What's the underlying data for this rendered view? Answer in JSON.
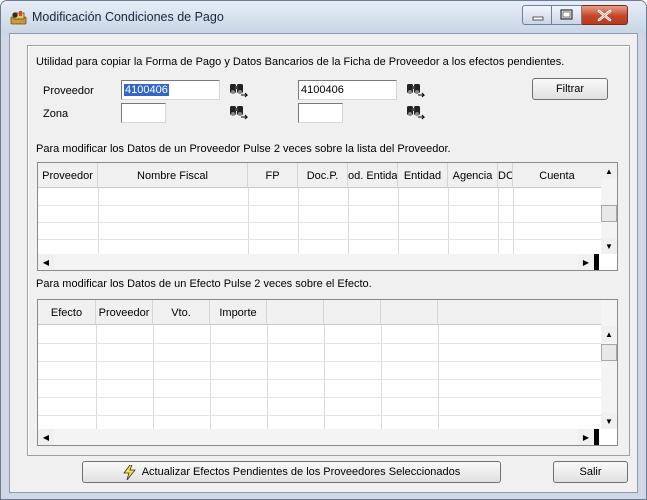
{
  "window": {
    "title": "Modificación Condiciones de Pago"
  },
  "header": {
    "info_text": "Utilidad para copiar la Forma de Pago y Datos Bancarios de la Ficha de Proveedor a los efectos pendientes."
  },
  "filters": {
    "proveedor_label": "Proveedor",
    "proveedor_from": "4100406",
    "proveedor_to": "4100406",
    "zona_label": "Zona",
    "zona_from": "",
    "zona_to": "",
    "filter_button": "Filtrar"
  },
  "suppliers": {
    "hint": "Para modificar los Datos de un Proveedor Pulse 2 veces sobre la lista del Proveedor.",
    "columns": [
      "Proveedor",
      "Nombre Fiscal",
      "FP",
      "Doc.P.",
      "od. Entida",
      "Entidad",
      "Agencia",
      "DC",
      "Cuenta"
    ]
  },
  "effects": {
    "hint": "Para modificar los Datos de un Efecto Pulse 2 veces sobre el Efecto.",
    "columns": [
      "Efecto",
      "Proveedor",
      "Vto.",
      "Importe",
      "",
      "",
      "",
      ""
    ]
  },
  "footer": {
    "update_button": "Actualizar Efectos Pendientes de los Proveedores Seleccionados",
    "exit_button": "Salir"
  }
}
